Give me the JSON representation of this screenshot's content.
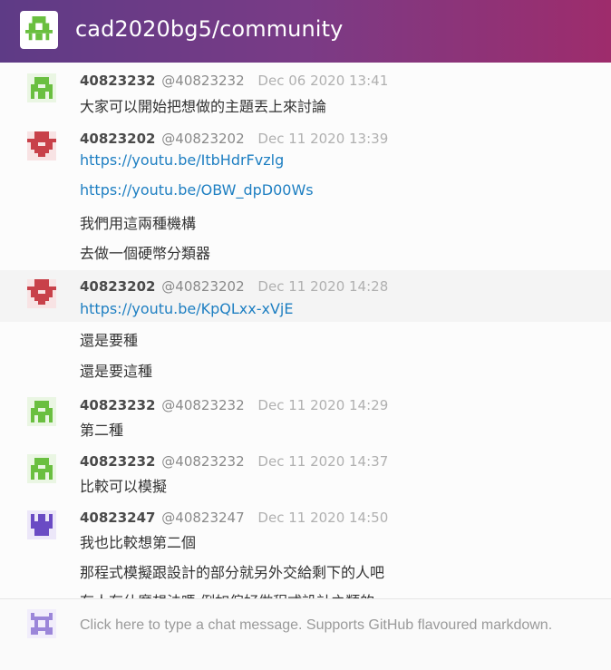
{
  "header": {
    "title": "cad2020bg5/community"
  },
  "messages": [
    {
      "name": "40823232",
      "handle": "@40823232",
      "time": "Dec 06 2020 13:41",
      "avatar": "green-identicon",
      "lines": [
        {
          "text": "大家可以開始把想做的主題丟上來討論",
          "link": false
        }
      ]
    },
    {
      "name": "40823202",
      "handle": "@40823202",
      "time": "Dec 11 2020 13:39",
      "avatar": "red-identicon",
      "lines": [
        {
          "text": "https://youtu.be/ItbHdrFvzlg",
          "link": true
        },
        {
          "text": "https://youtu.be/OBW_dpD00Ws",
          "link": true
        },
        {
          "text": "我們用這兩種機構",
          "link": false
        },
        {
          "text": "去做一個硬幣分類器",
          "link": false
        }
      ]
    },
    {
      "name": "40823202",
      "handle": "@40823202",
      "time": "Dec 11 2020 14:28",
      "avatar": "red-identicon",
      "lines": [
        {
          "text": "https://youtu.be/KpQLxx-xVjE",
          "link": true
        },
        {
          "text": "還是要種",
          "link": false
        },
        {
          "text": "還是要這種",
          "link": false
        }
      ]
    },
    {
      "name": "40823232",
      "handle": "@40823232",
      "time": "Dec 11 2020 14:29",
      "avatar": "green-identicon",
      "lines": [
        {
          "text": "第二種",
          "link": false
        }
      ]
    },
    {
      "name": "40823232",
      "handle": "@40823232",
      "time": "Dec 11 2020 14:37",
      "avatar": "green-identicon",
      "lines": [
        {
          "text": "比較可以模擬",
          "link": false
        }
      ]
    },
    {
      "name": "40823247",
      "handle": "@40823247",
      "time": "Dec 11 2020 14:50",
      "avatar": "purple-identicon",
      "lines": [
        {
          "text": "我也比較想第二個",
          "link": false
        },
        {
          "text": "那程式模擬跟設計的部分就另外交給剩下的人吧",
          "link": false
        },
        {
          "text": "有人有什麼想法嗎 例如偏好做程式設計之類的",
          "link": false
        }
      ]
    }
  ],
  "composer": {
    "placeholder": "Click here to type a chat message. Supports GitHub flavoured markdown.",
    "avatar": "lavender-identicon"
  },
  "colors": {
    "header_start": "#5e3b86",
    "header_end": "#9e2c6c",
    "link": "#1e7fc2",
    "green_avatar": "#6abf40",
    "red_avatar": "#c8414a",
    "purple_avatar": "#6a4bc4",
    "lavender_avatar": "#9b86d9"
  }
}
